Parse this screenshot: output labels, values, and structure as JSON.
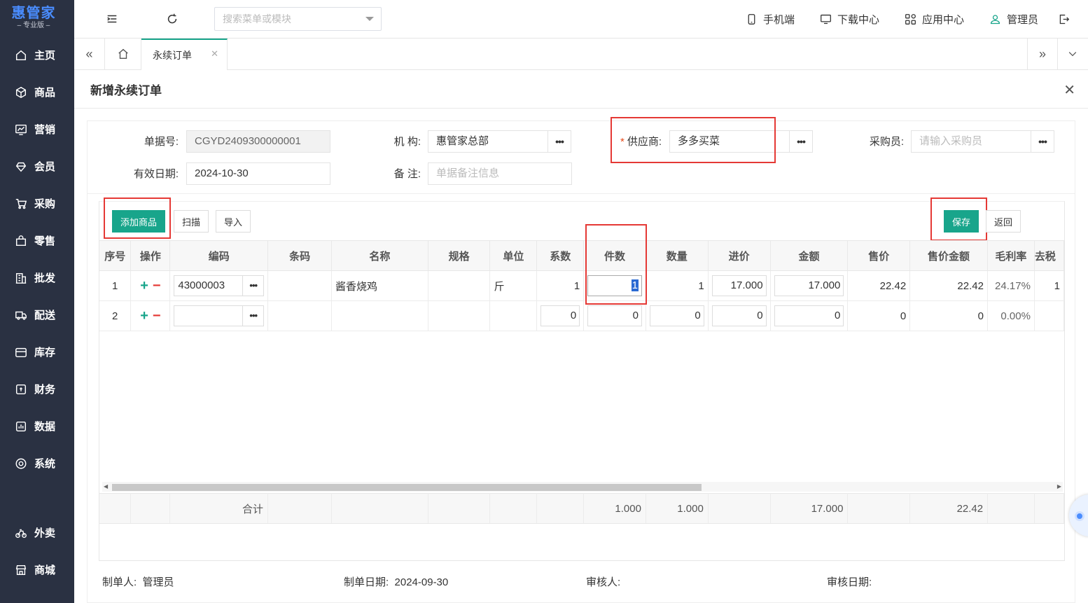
{
  "logo": {
    "brand": "惠管家",
    "edition": "专业版"
  },
  "sidebar": {
    "items": [
      {
        "label": "主页",
        "icon": "home-icon"
      },
      {
        "label": "商品",
        "icon": "box-icon"
      },
      {
        "label": "营销",
        "icon": "chart-icon"
      },
      {
        "label": "会员",
        "icon": "diamond-icon"
      },
      {
        "label": "采购",
        "icon": "cart-icon"
      },
      {
        "label": "零售",
        "icon": "bag-icon"
      },
      {
        "label": "批发",
        "icon": "building-icon"
      },
      {
        "label": "配送",
        "icon": "truck-icon"
      },
      {
        "label": "库存",
        "icon": "warehouse-icon"
      },
      {
        "label": "财务",
        "icon": "finance-icon"
      },
      {
        "label": "数据",
        "icon": "data-icon"
      },
      {
        "label": "系统",
        "icon": "settings-icon"
      }
    ],
    "bottom_items": [
      {
        "label": "外卖",
        "icon": "bike-icon"
      },
      {
        "label": "商城",
        "icon": "store-icon"
      }
    ]
  },
  "topbar": {
    "search_placeholder": "搜索菜单或模块",
    "links": {
      "mobile": "手机端",
      "download": "下载中心",
      "apps": "应用中心",
      "user": "管理员"
    }
  },
  "tabs": {
    "active": "永续订单"
  },
  "panel": {
    "title": "新增永续订单",
    "form": {
      "doc_no_label": "单据号:",
      "doc_no": "CGYD2409300000001",
      "org_label": "机 构:",
      "org": "惠管家总部",
      "supplier_label": "供应商:",
      "supplier_required": "*",
      "supplier": "多多买菜",
      "buyer_label": "采购员:",
      "buyer_placeholder": "请输入采购员",
      "valid_date_label": "有效日期:",
      "valid_date": "2024-10-30",
      "remark_label": "备 注:",
      "remark_placeholder": "单据备注信息"
    },
    "toolbar": {
      "add_goods": "添加商品",
      "scan": "扫描",
      "import": "导入",
      "save": "保存",
      "back": "返回"
    },
    "table": {
      "headers": [
        "序号",
        "操作",
        "编码",
        "条码",
        "名称",
        "规格",
        "单位",
        "系数",
        "件数",
        "数量",
        "进价",
        "金额",
        "售价",
        "售价金额",
        "毛利率",
        "去税"
      ],
      "rows": [
        {
          "seq": "1",
          "code": "43000003",
          "barcode": "",
          "name": "酱香烧鸡",
          "spec": "",
          "unit": "斤",
          "factor": "1",
          "pieces": "1",
          "qty": "1",
          "cost": "17.000",
          "amount": "17.000",
          "price": "22.42",
          "price_amount": "22.42",
          "margin": "24.17%",
          "notax": "1"
        },
        {
          "seq": "2",
          "code": "",
          "barcode": "",
          "name": "",
          "spec": "",
          "unit": "",
          "factor": "0",
          "pieces": "0",
          "qty": "0",
          "cost": "0",
          "amount": "0",
          "price": "0",
          "price_amount": "0",
          "margin": "0.00%",
          "notax": ""
        }
      ],
      "totals": {
        "label": "合计",
        "pieces": "1.000",
        "qty": "1.000",
        "amount": "17.000",
        "price_amount": "22.42"
      }
    },
    "footer": {
      "creator_label": "制单人:",
      "creator": "管理员",
      "created_label": "制单日期:",
      "created": "2024-09-30",
      "auditor_label": "审核人:",
      "auditor": "",
      "audit_date_label": "审核日期:",
      "audit_date": ""
    }
  },
  "colors": {
    "accent": "#18a58b",
    "sidebar": "#2a3142",
    "highlight_box": "#e53935"
  }
}
